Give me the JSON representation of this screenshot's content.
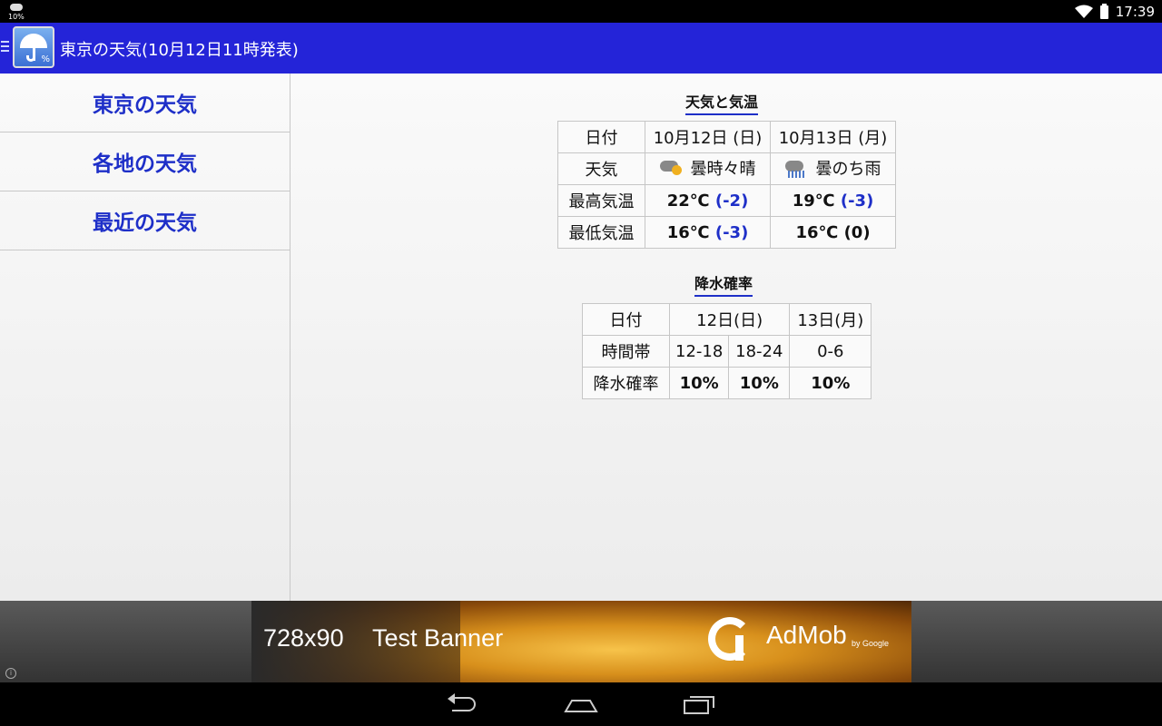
{
  "status_bar": {
    "notification_percent": "10%",
    "time": "17:39"
  },
  "action_bar": {
    "app_icon_percent": "%",
    "title": "東京の天気(10月12日11時発表)"
  },
  "sidebar": {
    "items": [
      {
        "label": "東京の天気"
      },
      {
        "label": "各地の天気"
      },
      {
        "label": "最近の天気"
      }
    ]
  },
  "weather_section": {
    "title": "天気と気温",
    "date_label": "日付",
    "weather_label": "天気",
    "high_label": "最高気温",
    "low_label": "最低気温",
    "days": [
      {
        "date": "10月12日 (日)",
        "weather": "曇時々晴",
        "icon": "cloudy-sunny-icon",
        "high": "22℃",
        "high_diff": "(-2)",
        "low": "16℃",
        "low_diff": "(-3)"
      },
      {
        "date": "10月13日 (月)",
        "weather": "曇のち雨",
        "icon": "cloudy-rain-icon",
        "high": "19℃",
        "high_diff": "(-3)",
        "low": "16℃",
        "low_diff": "(0)"
      }
    ]
  },
  "precip_section": {
    "title": "降水確率",
    "date_label": "日付",
    "time_label": "時間帯",
    "prob_label": "降水確率",
    "dates": [
      "12日(日)",
      "13日(月)"
    ],
    "slots": [
      {
        "time": "12-18",
        "prob": "10%"
      },
      {
        "time": "18-24",
        "prob": "10%"
      },
      {
        "time": "0-6",
        "prob": "10%"
      }
    ]
  },
  "ad": {
    "size": "728x90",
    "text": "Test Banner",
    "brand": "AdMob",
    "by": "by Google"
  },
  "colors": {
    "action_bar": "#2424d8",
    "accent": "#1e2fc8"
  }
}
